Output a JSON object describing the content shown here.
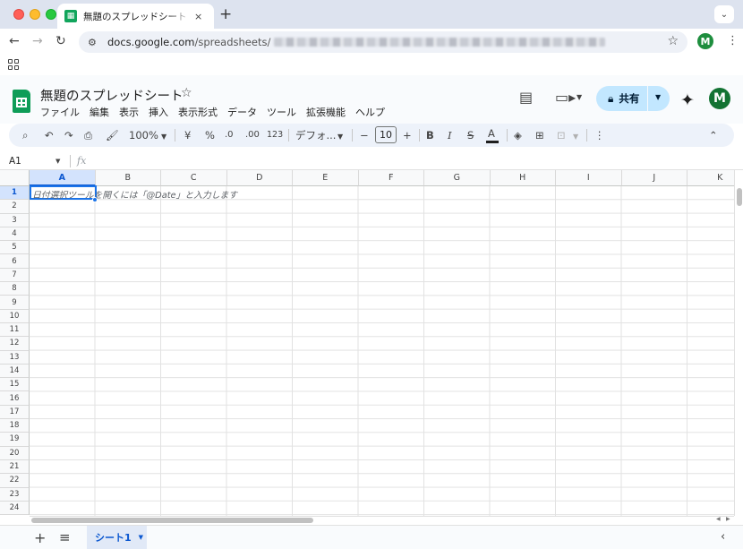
{
  "browser": {
    "tab_title": "無題のスプレッドシート - Google スプレッドシート",
    "tab_close": "×",
    "new_tab": "+",
    "url_domain": "docs.google.com",
    "url_path": "/spreadsheets/",
    "profile_initial": "M"
  },
  "sheets": {
    "doc_title": "無題のスプレッドシート",
    "menu": [
      "ファイル",
      "編集",
      "表示",
      "挿入",
      "表示形式",
      "データ",
      "ツール",
      "拡張機能",
      "ヘルプ"
    ],
    "share_label": "共有",
    "avatar_initial": "M"
  },
  "toolbar": {
    "zoom": "100%",
    "currency": "¥",
    "percent": "%",
    "decrease_decimal": ".0",
    "increase_decimal": ".00",
    "more_formats": "123",
    "font": "デフォ...",
    "font_size": "10",
    "bold": "B",
    "italic": "I",
    "strike": "S",
    "text_color": "A"
  },
  "formula_bar": {
    "name_box": "A1",
    "fx": "fx"
  },
  "grid": {
    "columns": [
      "A",
      "B",
      "C",
      "D",
      "E",
      "F",
      "G",
      "H",
      "I",
      "J",
      "K"
    ],
    "rows": [
      "1",
      "2",
      "3",
      "4",
      "5",
      "6",
      "7",
      "8",
      "9",
      "10",
      "11",
      "12",
      "13",
      "14",
      "15",
      "16",
      "17",
      "18",
      "19",
      "20",
      "21",
      "22",
      "23",
      "24"
    ],
    "selected_column": "A",
    "selected_row": "1",
    "hint_text": "日付選択ツールを開くには「@Date」と入力します"
  },
  "sheet_tabs": {
    "add": "+",
    "active_tab": "シート1"
  },
  "colors": {
    "sheets_green": "#0f9d58",
    "selection_blue": "#1a73e8",
    "share_bg": "#c2e7ff",
    "toolbar_bg": "#edf2fa"
  }
}
